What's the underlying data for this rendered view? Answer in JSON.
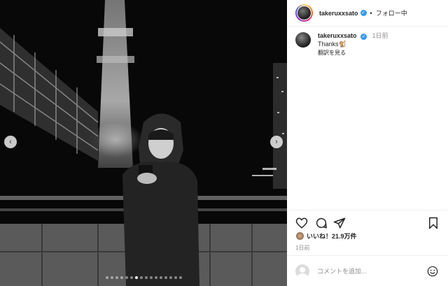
{
  "post": {
    "username": "takeruxxsato",
    "separator": "•",
    "follow_status": "フォロー中"
  },
  "comment": {
    "username": "takeruxxsato",
    "time": "1日前",
    "text": "Thanks🐒",
    "translate": "翻訳を見る"
  },
  "likes": {
    "text": "いいね！21.9万件"
  },
  "post_time": "1日前",
  "add_comment": {
    "placeholder": "コメントを追加..."
  },
  "carousel": {
    "prev": "‹",
    "next": "›",
    "dot_count": 16,
    "active_dot": 6
  },
  "colors": {
    "verified": "#3897f0",
    "text": "#262626",
    "muted": "#8e8e8e"
  }
}
